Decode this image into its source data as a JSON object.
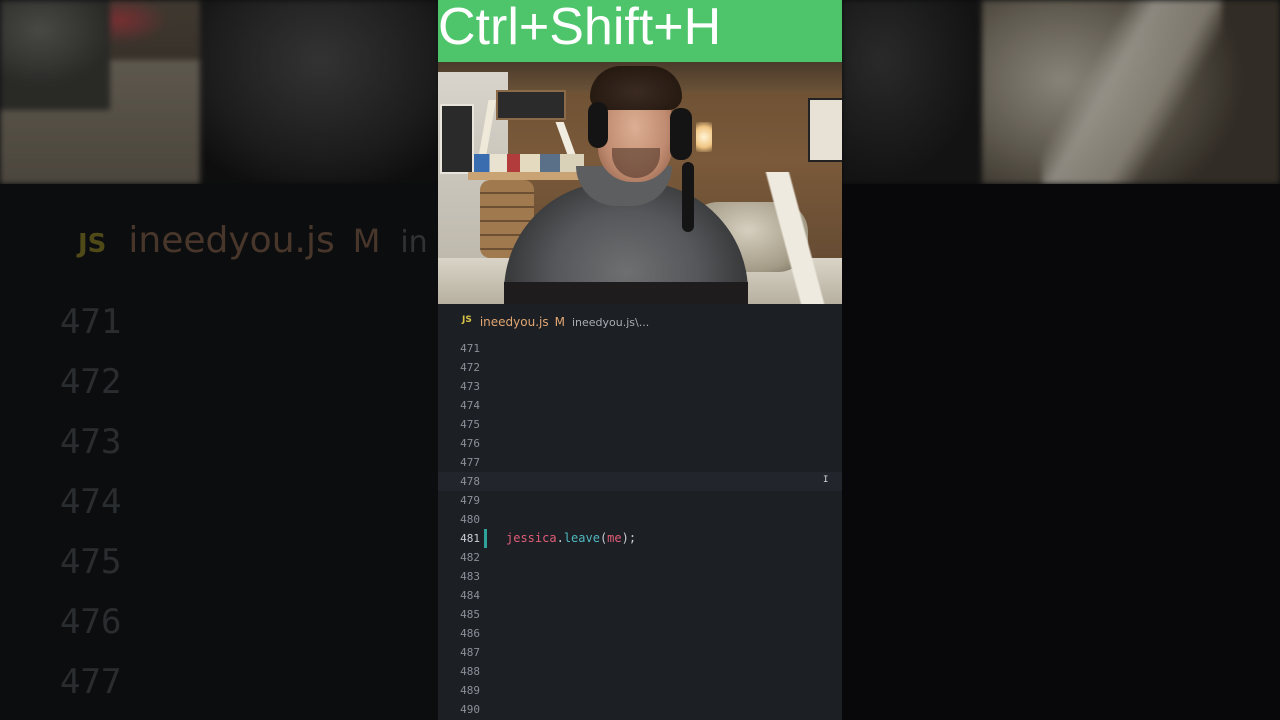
{
  "banner": {
    "shortcut": "Ctrl+Shift+H",
    "background": "#4fc56b"
  },
  "editor": {
    "tab": {
      "icon_label": "JS",
      "file_name": "ineedyou.js",
      "modified_flag": "M",
      "path": "ineedyou.js\\..."
    },
    "lines": [
      {
        "number": "471",
        "code": ""
      },
      {
        "number": "472",
        "code": ""
      },
      {
        "number": "473",
        "code": ""
      },
      {
        "number": "474",
        "code": ""
      },
      {
        "number": "475",
        "code": ""
      },
      {
        "number": "476",
        "code": ""
      },
      {
        "number": "477",
        "code": ""
      },
      {
        "number": "478",
        "code": ""
      },
      {
        "number": "479",
        "code": ""
      },
      {
        "number": "480",
        "code": ""
      },
      {
        "number": "481",
        "code": "jessica.leave(me);"
      },
      {
        "number": "482",
        "code": ""
      },
      {
        "number": "483",
        "code": ""
      },
      {
        "number": "484",
        "code": ""
      },
      {
        "number": "485",
        "code": ""
      },
      {
        "number": "486",
        "code": ""
      },
      {
        "number": "487",
        "code": ""
      },
      {
        "number": "488",
        "code": ""
      },
      {
        "number": "489",
        "code": ""
      },
      {
        "number": "490",
        "code": ""
      }
    ],
    "code_tokens": {
      "object": "jessica",
      "dot": ".",
      "method": "leave",
      "open_paren": "(",
      "argument": "me",
      "close": ");"
    },
    "colors": {
      "background": "#1c1f24",
      "line_number": "#8a9099",
      "identifier": "#e05d77",
      "method": "#4fb8c0",
      "modified_gutter": "#2fa39a",
      "tab_file": "#e2a672"
    }
  },
  "background_zoom": {
    "icon_label": "JS",
    "file_name": "ineedyou.js",
    "modified_flag": "M",
    "path_fragment": "in",
    "line_numbers": [
      "471",
      "472",
      "473",
      "474",
      "475",
      "476",
      "477"
    ]
  }
}
